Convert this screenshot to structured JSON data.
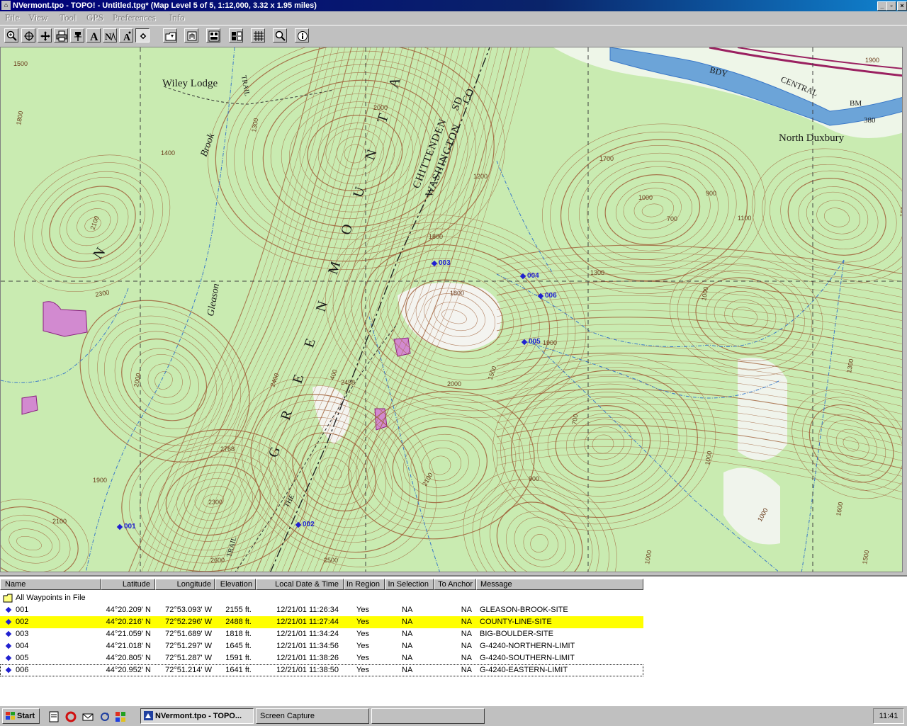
{
  "window": {
    "title": "NVermont.tpo - TOPO! - Untitled.tpg*   (Map Level 5 of 5, 1:12,000, 3.32 x 1.95 miles)",
    "minimize": "_",
    "restore": "▫",
    "close": "×"
  },
  "menu": [
    "File",
    "View",
    "Tool",
    "GPS",
    "Preferences",
    "Info"
  ],
  "toolbar": {
    "icons": [
      "zoom-icon",
      "center-icon",
      "pan-icon",
      "print-icon",
      "pin-icon",
      "text-icon",
      "profile-icon",
      "elevation-icon",
      "waypoint-icon",
      "open-icon",
      "hand-icon",
      "gps-icon",
      "gps-transfer-icon",
      "grid-icon",
      "magnify-icon",
      "info-icon"
    ]
  },
  "map": {
    "labels": {
      "wiley_lodge": "Wiley Lodge",
      "north_duxbury": "North Duxbury",
      "brook": "Brook",
      "gleason": "Gleason",
      "trail_top": "TRAIL",
      "trail_bottom": "TRAIL",
      "the": "THE",
      "green_mountains": "G R E E N   M O U N T A",
      "chittenden": "CHITTENDEN",
      "washington": "WASHINGTON",
      "co": "CO",
      "sd": "SD",
      "n_letter": "N",
      "bdy": "BDY",
      "central": "CENTRAL",
      "bm": "BM",
      "bm_elev": "380"
    },
    "contour_labels": [
      {
        "text": "1500"
      },
      {
        "text": "1800"
      },
      {
        "text": "1300"
      },
      {
        "text": "1400"
      },
      {
        "text": "2100"
      },
      {
        "text": "2300"
      },
      {
        "text": "2000"
      },
      {
        "text": "1900"
      },
      {
        "text": "2100"
      },
      {
        "text": "2300"
      },
      {
        "text": "2600"
      },
      {
        "text": "2500"
      },
      {
        "text": "2768"
      },
      {
        "text": "2400"
      },
      {
        "text": "2000"
      },
      {
        "text": "1800"
      },
      {
        "text": "1800"
      },
      {
        "text": "2000"
      },
      {
        "text": "1900"
      },
      {
        "text": "1500"
      },
      {
        "text": "1200"
      },
      {
        "text": "1700"
      },
      {
        "text": "1000"
      },
      {
        "text": "700"
      },
      {
        "text": "900"
      },
      {
        "text": "1100"
      },
      {
        "text": "1300"
      },
      {
        "text": "1000"
      },
      {
        "text": "700"
      },
      {
        "text": "1000"
      },
      {
        "text": "1300"
      },
      {
        "text": "1500"
      },
      {
        "text": "1000"
      },
      {
        "text": "900"
      },
      {
        "text": "1000"
      },
      {
        "text": "1600"
      },
      {
        "text": "1900"
      },
      {
        "text": "1500"
      },
      {
        "text": "400"
      },
      {
        "text": "2100"
      },
      {
        "text": "2458"
      }
    ],
    "waypoints": [
      {
        "id": "001"
      },
      {
        "id": "002"
      },
      {
        "id": "003"
      },
      {
        "id": "004"
      },
      {
        "id": "005"
      },
      {
        "id": "006"
      }
    ]
  },
  "list": {
    "columns": [
      "Name",
      "Latitude",
      "Longitude",
      "Elevation",
      "Local Date & Time",
      "In Region",
      "In Selection",
      "To Anchor",
      "Message"
    ],
    "group_label": "All Waypoints in File",
    "rows": [
      {
        "name": "001",
        "lat": "44°20.209' N",
        "lon": "72°53.093' W",
        "elev": "2155 ft.",
        "time": "12/21/01 11:26:34",
        "region": "Yes",
        "sel": "NA",
        "anchor": "NA",
        "msg": "GLEASON-BROOK-SITE"
      },
      {
        "name": "002",
        "lat": "44°20.216' N",
        "lon": "72°52.296' W",
        "elev": "2488 ft.",
        "time": "12/21/01 11:27:44",
        "region": "Yes",
        "sel": "NA",
        "anchor": "NA",
        "msg": "COUNTY-LINE-SITE",
        "selected": true
      },
      {
        "name": "003",
        "lat": "44°21.059' N",
        "lon": "72°51.689' W",
        "elev": "1818 ft.",
        "time": "12/21/01 11:34:24",
        "region": "Yes",
        "sel": "NA",
        "anchor": "NA",
        "msg": "BIG-BOULDER-SITE"
      },
      {
        "name": "004",
        "lat": "44°21.018' N",
        "lon": "72°51.297' W",
        "elev": "1645 ft.",
        "time": "12/21/01 11:34:56",
        "region": "Yes",
        "sel": "NA",
        "anchor": "NA",
        "msg": "G-4240-NORTHERN-LIMIT"
      },
      {
        "name": "005",
        "lat": "44°20.805' N",
        "lon": "72°51.287' W",
        "elev": "1591 ft.",
        "time": "12/21/01 11:38:26",
        "region": "Yes",
        "sel": "NA",
        "anchor": "NA",
        "msg": "G-4240-SOUTHERN-LIMIT"
      },
      {
        "name": "006",
        "lat": "44°20.952' N",
        "lon": "72°51.214' W",
        "elev": "1641 ft.",
        "time": "12/21/01 11:38:50",
        "region": "Yes",
        "sel": "NA",
        "anchor": "NA",
        "msg": "G-4240-EASTERN-LIMIT",
        "focused": true
      }
    ]
  },
  "taskbar": {
    "start": "Start",
    "tasks": [
      "NVermont.tpo - TOPO...",
      "Screen Capture"
    ],
    "clock": "11:41"
  },
  "colors": {
    "map_green": "#c9ebb1",
    "contour": "#a0603a",
    "water": "#3a78c8",
    "waypoint": "#2020d0",
    "highlight": "#ffff00"
  }
}
